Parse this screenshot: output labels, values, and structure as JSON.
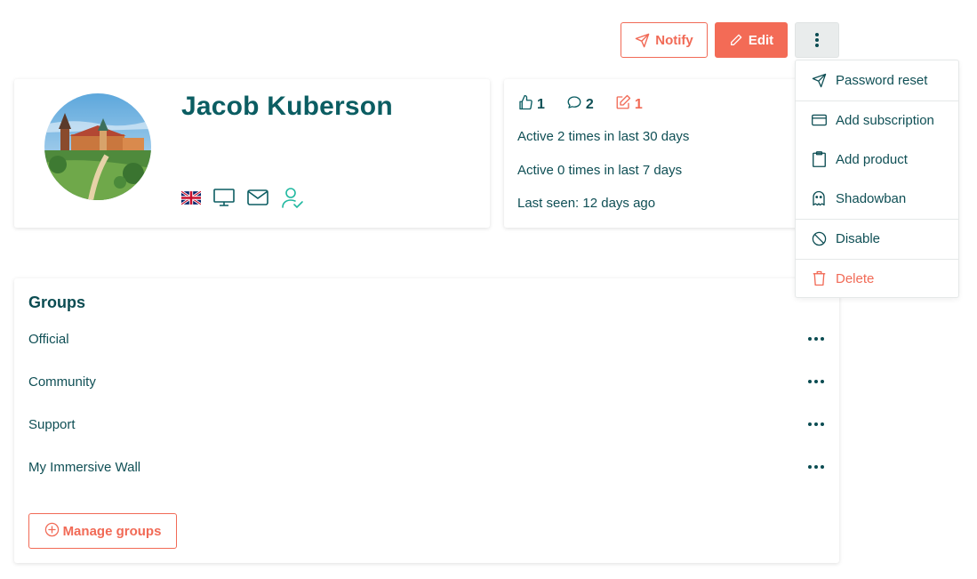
{
  "toolbar": {
    "notify_label": "Notify",
    "edit_label": "Edit",
    "more_icon": "vertical-ellipsis-icon"
  },
  "profile": {
    "name": "Jacob Kuberson",
    "avatar_description": "city-castle-photo",
    "meta_icons": [
      "uk-flag-icon",
      "desktop-icon",
      "mail-icon",
      "user-check-icon"
    ]
  },
  "activity": {
    "likes": "1",
    "comments": "2",
    "posts": "1",
    "line1": "Active 2 times in last 30 days",
    "line2": "Active 0 times in last 7 days",
    "line3": "Last seen: 12 days ago"
  },
  "menu": {
    "items": [
      {
        "label": "Password reset",
        "icon": "send-icon"
      },
      {
        "label": "Add subscription",
        "icon": "credit-card-icon"
      },
      {
        "label": "Add product",
        "icon": "clipboard-icon"
      },
      {
        "label": "Shadowban",
        "icon": "ghost-icon"
      },
      {
        "label": "Disable",
        "icon": "ban-icon"
      },
      {
        "label": "Delete",
        "icon": "trash-icon"
      }
    ]
  },
  "groups": {
    "title": "Groups",
    "items": [
      "Official",
      "Community",
      "Support",
      "My Immersive Wall"
    ],
    "manage_label": "Manage groups"
  },
  "colors": {
    "accent": "#f36b56",
    "text": "#0f4f55",
    "title": "#0b5d62",
    "success": "#20b8a0"
  }
}
